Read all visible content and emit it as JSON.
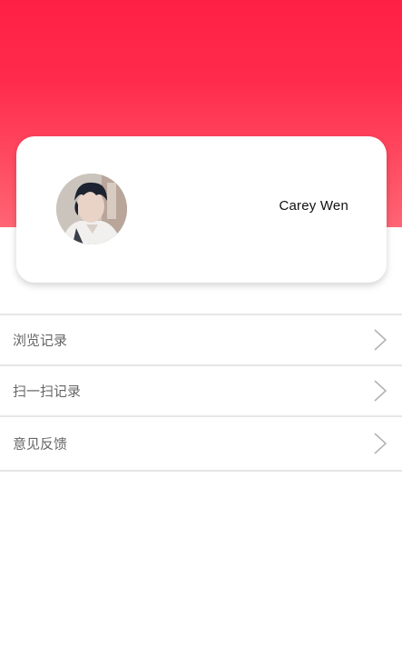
{
  "profile": {
    "user_name": "Carey Wen",
    "avatar_icon": "user-avatar-photo"
  },
  "menu": {
    "items": [
      {
        "label": "浏览记录",
        "icon": "chevron-right-icon"
      },
      {
        "label": "扫一扫记录",
        "icon": "chevron-right-icon"
      },
      {
        "label": "意见反馈",
        "icon": "chevron-right-icon"
      }
    ]
  },
  "colors": {
    "header_top": "#ff2145",
    "header_bottom": "#ff6574",
    "divider": "#e6e6e6",
    "menu_text": "#666666",
    "chevron": "#b3b3b3"
  }
}
